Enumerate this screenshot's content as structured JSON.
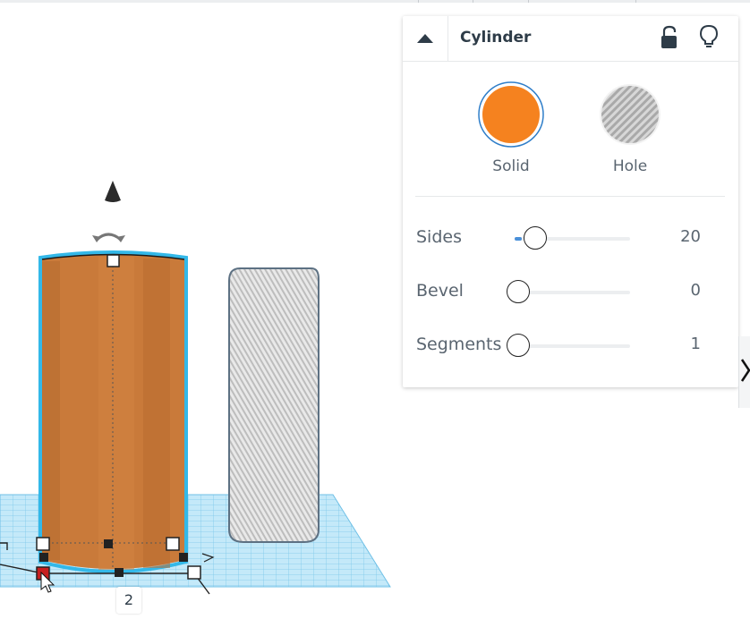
{
  "inspector": {
    "title": "Cylinder",
    "solid_label": "Solid",
    "hole_label": "Hole",
    "solid_color": "#f5821f",
    "selected_option": "Solid",
    "rows": [
      {
        "label": "Sides",
        "value": "20",
        "level": 0.02
      },
      {
        "label": "Bevel",
        "value": "0",
        "level": 0
      },
      {
        "label": "Segments",
        "value": "1",
        "level": 0
      }
    ]
  },
  "workplane": {
    "dimension_value": "2",
    "grid_color": "#9dd6f0",
    "selection_outline_color": "#33b8e8"
  },
  "icons": [
    "collapse-arrow-icon",
    "unlock-icon",
    "lightbulb-icon",
    "rotate-arrow-icon",
    "lift-cone-icon",
    "chevron-right-icon",
    "mouse-cursor-icon"
  ]
}
